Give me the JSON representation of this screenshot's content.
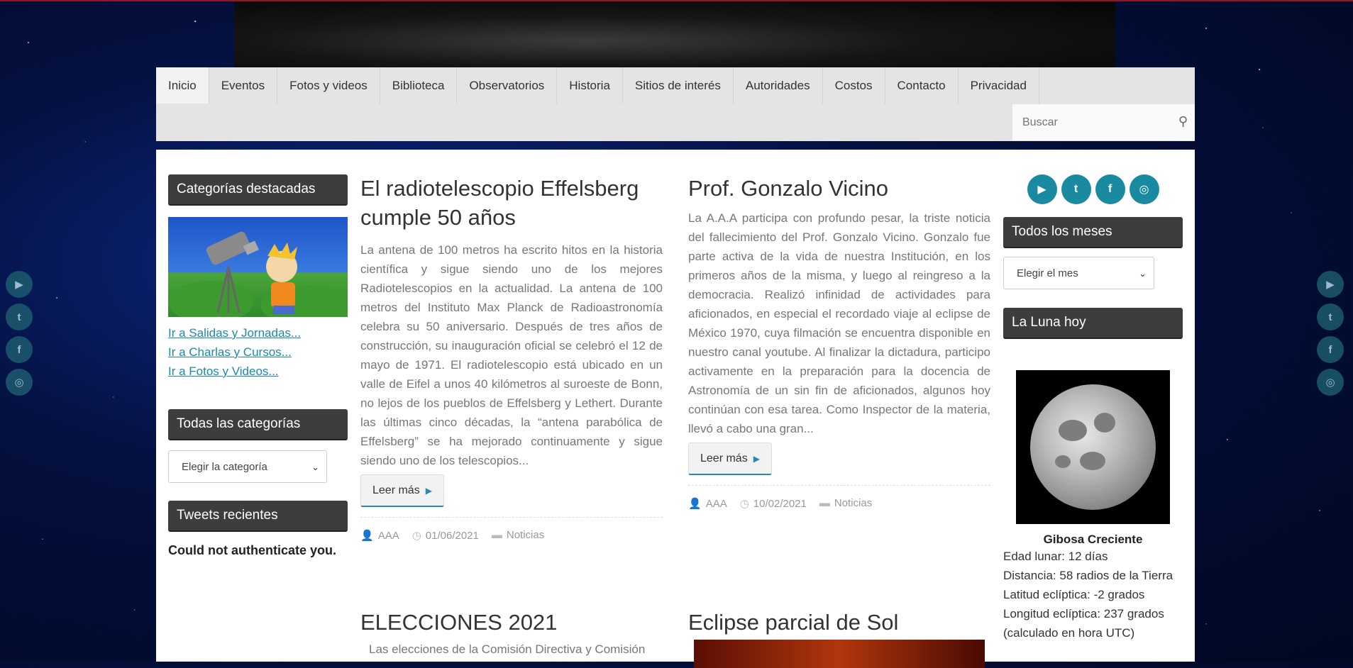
{
  "nav": {
    "items": [
      "Inicio",
      "Eventos",
      "Fotos y videos",
      "Biblioteca",
      "Observatorios",
      "Historia",
      "Sitios de interés",
      "Autoridades",
      "Costos",
      "Contacto",
      "Privacidad"
    ],
    "search_placeholder": "Buscar"
  },
  "left": {
    "featured_title": "Categorías destacadas",
    "links": [
      "Ir a Salidas y Jornadas...",
      "Ir a Charlas y Cursos...",
      "Ir a Fotos y Videos..."
    ],
    "all_categories_title": "Todas las categorías",
    "category_select": "Elegir la categoría",
    "tweets_title": "Tweets recientes",
    "tweets_msg": "Could not authenticate you."
  },
  "posts": [
    {
      "title": "El radiotelescopio Effelsberg cumple 50 años",
      "excerpt": "La antena de 100 metros ha escrito hitos en la historia científica y sigue siendo uno de los mejores Radiotelescopios en la actualidad. La antena de 100 metros del Instituto Max Planck de Radioastronomía celebra su 50 aniversario. Después de tres años de construcción, su inauguración oficial se celebró el 12 de mayo de 1971. El radiotelescopio está ubicado en un valle de Eifel a unos 40 kilómetros al suroeste de Bonn, no lejos de los pueblos de Effelsberg y Lethert. Durante las últimas cinco décadas, la “antena parabólica de Effelsberg” se ha mejorado continuamente y sigue siendo uno de los telescopios...",
      "more": "Leer más",
      "author": "AAA",
      "date": "01/06/2021",
      "category": "Noticias"
    },
    {
      "title": "Prof. Gonzalo Vicino",
      "excerpt": "La A.A.A participa con profundo pesar, la triste noticia del fallecimiento del Prof. Gonzalo Vicino. Gonzalo fue parte activa de la vida de nuestra Institución, en los primeros años de la misma, y luego al reingreso a la democracia. Realizó infinidad de actividades para aficionados, en especial el recordado viaje al eclipse de México 1970, cuya filmación se encuentra disponible en nuestro canal youtube. Al finalizar la dictadura, participo activamente en la preparación para la docencia de Astronomía de un sin fin de aficionados, algunos hoy continúan con esa tarea. Como Inspector de la materia, llevó a cabo una gran...",
      "more": "Leer más",
      "author": "AAA",
      "date": "10/02/2021",
      "category": "Noticias"
    },
    {
      "title": "ELECCIONES 2021",
      "excerpt": "Las elecciones de la Comisión Directiva y Comisión"
    },
    {
      "title": "Eclipse parcial de Sol"
    }
  ],
  "right": {
    "social": [
      "youtube-icon",
      "twitter-icon",
      "facebook-icon",
      "instagram-icon"
    ],
    "months_title": "Todos los meses",
    "month_select": "Elegir el mes",
    "moon_title": "La Luna hoy",
    "moon_phase": "Gibosa Creciente",
    "moon_info": [
      "Edad lunar: 12 días",
      "Distancia: 58 radios de la Tierra",
      "Latitud eclíptica: -2 grados",
      "Longitud eclíptica: 237 grados",
      "(calculado en hora UTC)"
    ]
  },
  "colors": {
    "accent": "#1a8aa0",
    "nav_bg": "#e4e4e4",
    "widget_title_bg": "#3d3d3d"
  }
}
